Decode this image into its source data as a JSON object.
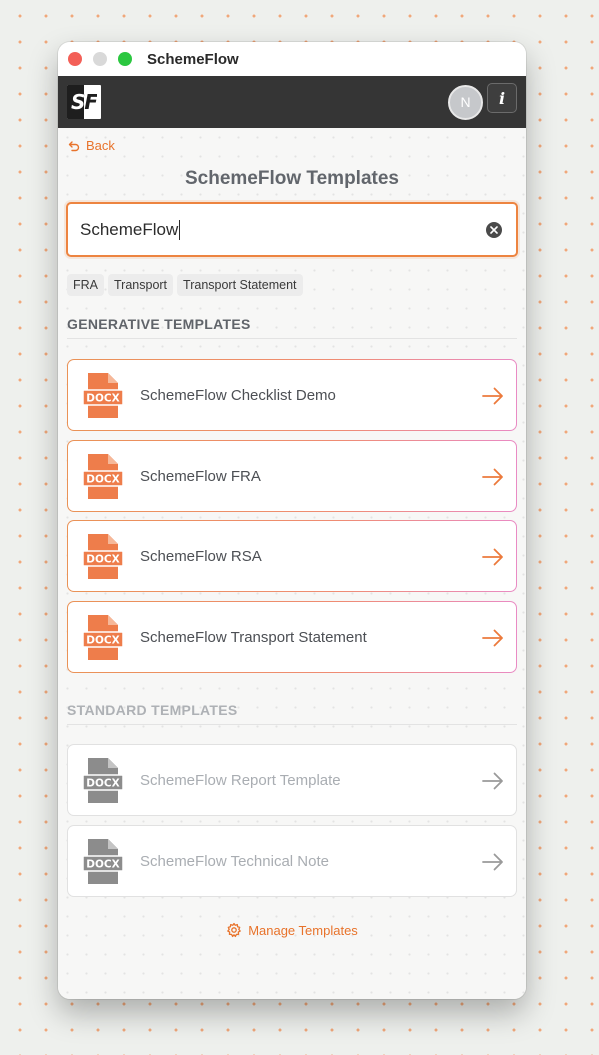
{
  "window": {
    "title": "SchemeFlow"
  },
  "appbar": {
    "logo_text": "SF",
    "avatar_initial": "N",
    "info_label": "i"
  },
  "nav": {
    "back_label": "Back"
  },
  "page": {
    "title": "SchemeFlow Templates"
  },
  "search": {
    "value": "SchemeFlow"
  },
  "filters": [
    "FRA",
    "Transport",
    "Transport Statement"
  ],
  "generative": {
    "heading": "GENERATIVE TEMPLATES",
    "items": [
      {
        "label": "SchemeFlow Checklist Demo",
        "badge": "DOCX"
      },
      {
        "label": "SchemeFlow FRA",
        "badge": "DOCX"
      },
      {
        "label": "SchemeFlow RSA",
        "badge": "DOCX"
      },
      {
        "label": "SchemeFlow Transport Statement",
        "badge": "DOCX"
      }
    ]
  },
  "standard": {
    "heading": "STANDARD TEMPLATES",
    "items": [
      {
        "label": "SchemeFlow Report Template",
        "badge": "DOCX"
      },
      {
        "label": "SchemeFlow Technical Note",
        "badge": "DOCX"
      }
    ]
  },
  "footer": {
    "manage_label": "Manage Templates"
  },
  "colors": {
    "accent": "#e8732b",
    "generative_icon": "#ee7d4b",
    "standard_icon": "#8c8c8c",
    "appbar": "#353535"
  },
  "icons": {
    "back": "undo-arrow-icon",
    "clear": "clear-circle-icon",
    "file": "docx-file-icon",
    "arrow": "arrow-right-icon",
    "manage": "gear-icon"
  }
}
